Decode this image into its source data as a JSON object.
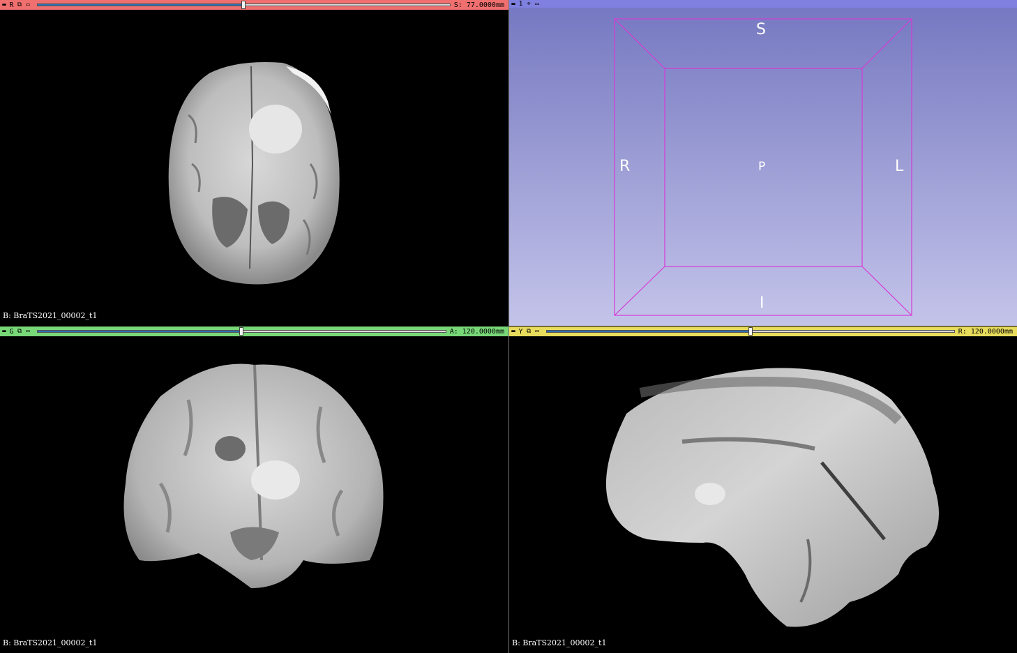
{
  "views": {
    "red": {
      "letter": "R",
      "offset": "S: 77.0000mm",
      "slider_fraction": 0.5,
      "color": "#f07070",
      "volume_label": "B: BraTS2021_00002_t1"
    },
    "threed": {
      "letter": "1",
      "color": "#8080e0",
      "orientation": {
        "top": "S",
        "bottom": "I",
        "left": "R",
        "right": "L",
        "center": "P"
      }
    },
    "green": {
      "letter": "G",
      "offset": "A: 120.0000mm",
      "slider_fraction": 0.5,
      "color": "#78d878",
      "volume_label": "B: BraTS2021_00002_t1"
    },
    "yellow": {
      "letter": "Y",
      "offset": "R: 120.0000mm",
      "slider_fraction": 0.5,
      "color": "#e8dc5c",
      "volume_label": "B: BraTS2021_00002_t1"
    }
  },
  "icons": {
    "pin": "pin-icon",
    "link": "link-icon",
    "maximize": "maximize-icon",
    "center": "center-view-icon"
  }
}
